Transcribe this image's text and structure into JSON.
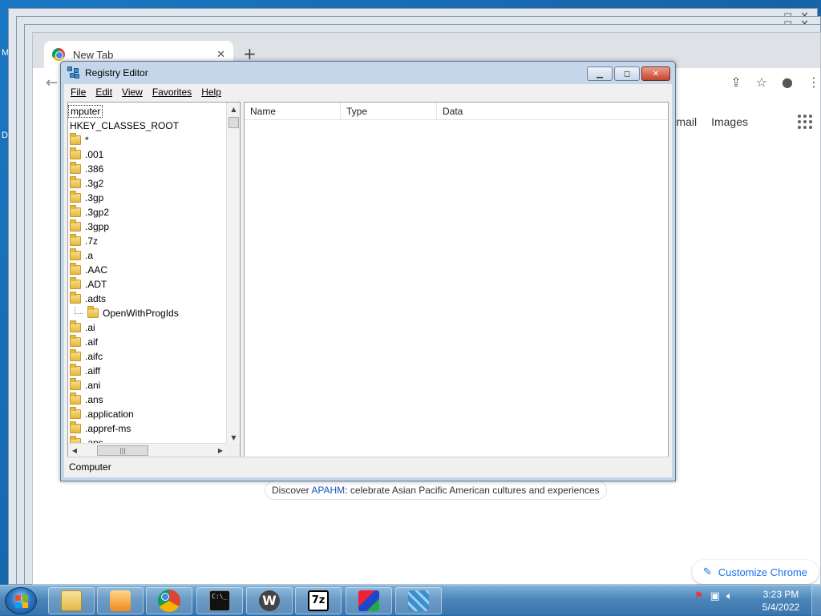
{
  "desktop": {
    "side_letters": [
      "M",
      "D"
    ]
  },
  "chrome": {
    "tab_title": "New Tab",
    "links": [
      "Gmail",
      "Images"
    ],
    "discover": {
      "prefix": "Discover ",
      "link": "APAHM",
      "suffix": ": celebrate Asian Pacific American cultures and experiences"
    },
    "customize_label": "Customize Chrome"
  },
  "regedit": {
    "title": "Registry Editor",
    "menu": [
      "File",
      "Edit",
      "View",
      "Favorites",
      "Help"
    ],
    "tree": {
      "root_label": "mputer",
      "hive": "HKEY_CLASSES_ROOT",
      "keys": [
        "*",
        ".001",
        ".386",
        ".3g2",
        ".3gp",
        ".3gp2",
        ".3gpp",
        ".7z",
        ".a",
        ".AAC",
        ".ADT",
        ".adts",
        "OpenWithProgIds",
        ".ai",
        ".aif",
        ".aifc",
        ".aiff",
        ".ani",
        ".ans",
        ".application",
        ".appref-ms",
        ".aps"
      ]
    },
    "columns": [
      "Name",
      "Type",
      "Data"
    ],
    "status": "Computer"
  },
  "taskbar": {
    "time": "3:23 PM",
    "date": "5/4/2022"
  },
  "icons": {
    "explorer": "folder-icon",
    "media": "media-player-icon",
    "chrome": "chrome-icon",
    "cmd": "command-prompt-icon",
    "wordpress": "wordpress-icon",
    "sevenzip": "7zip-icon",
    "app": "3d-box-icon",
    "registry": "registry-icon"
  }
}
